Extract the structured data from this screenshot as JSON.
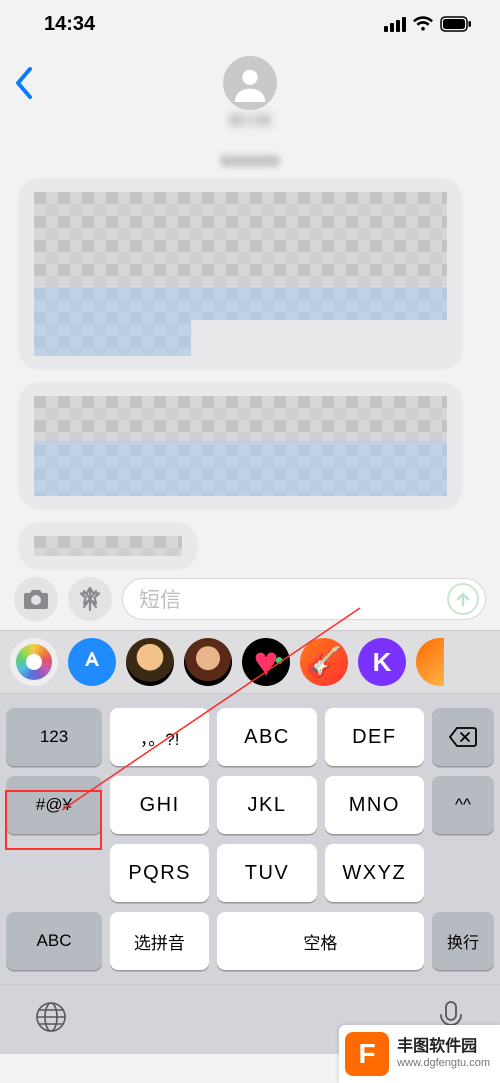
{
  "status": {
    "time": "14:34"
  },
  "header": {
    "contact_name": "██"
  },
  "compose": {
    "placeholder": "短信",
    "camera_icon": "camera-icon",
    "appstore_icon": "appstore-icon",
    "send_icon": "send-up-icon"
  },
  "app_strip": [
    {
      "id": "photos",
      "label": "Photos"
    },
    {
      "id": "appstore",
      "label": "App Store"
    },
    {
      "id": "memoji1",
      "label": "Memoji"
    },
    {
      "id": "memoji2",
      "label": "Memoji"
    },
    {
      "id": "heart",
      "label": "Digital Touch"
    },
    {
      "id": "garageband",
      "label": "GarageBand"
    },
    {
      "id": "k",
      "label": "K"
    },
    {
      "id": "partial",
      "label": ""
    }
  ],
  "keyboard": {
    "rows": [
      [
        "123",
        "，。?!",
        "ABC",
        "DEF",
        "⌫"
      ],
      [
        "#@¥",
        "GHI",
        "JKL",
        "MNO",
        "^^"
      ],
      [
        "",
        "PQRS",
        "TUV",
        "WXYZ",
        ""
      ],
      [
        "ABC",
        "选拼音",
        "空格",
        "换行"
      ]
    ],
    "key_123": "123",
    "key_punct": "，。?!",
    "key_abc1": "ABC",
    "key_def": "DEF",
    "key_sym": "#@¥",
    "key_ghi": "GHI",
    "key_jkl": "JKL",
    "key_mno": "MNO",
    "key_emoji": "^^",
    "key_pqrs": "PQRS",
    "key_tuv": "TUV",
    "key_wxyz": "WXYZ",
    "key_mode_abc": "ABC",
    "key_pinyin": "选拼音",
    "key_space": "空格",
    "key_return": "换行"
  },
  "annotation": {
    "highlight_target": "#@¥"
  },
  "watermark": {
    "badge": "F",
    "title": "丰图软件园",
    "url": "www.dgfengtu.com"
  }
}
